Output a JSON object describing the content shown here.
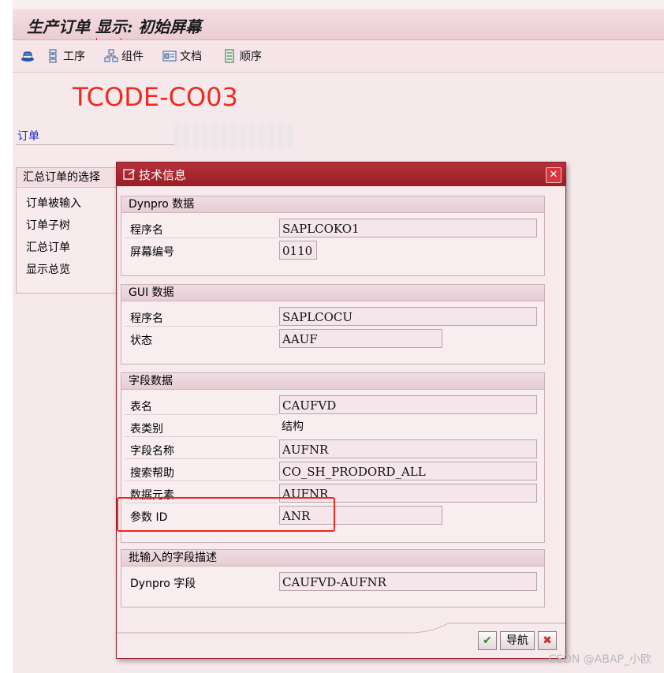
{
  "app": {
    "title": "生产订单 显示: 初始屏幕",
    "toolbar": [
      {
        "icon": "hat-icon",
        "label": ""
      },
      {
        "icon": "operations-icon",
        "label": "工序"
      },
      {
        "icon": "components-icon",
        "label": "组件"
      },
      {
        "icon": "documents-icon",
        "label": "文档"
      },
      {
        "icon": "sequence-icon",
        "label": "顺序"
      }
    ],
    "annotation": "TCODE-CO03",
    "order_label": "订单",
    "summary": {
      "title": "汇总订单的选择",
      "items": [
        "订单被输入",
        "订单子树",
        "汇总订单",
        "显示总览"
      ]
    }
  },
  "dialog": {
    "title": "技术信息",
    "groups": [
      {
        "title": "Dynpro 数据",
        "rows": [
          {
            "label": "程序名",
            "value": "SAPLCOKO1"
          },
          {
            "label": "屏幕编号",
            "value": "0110"
          }
        ]
      },
      {
        "title": "GUI 数据",
        "rows": [
          {
            "label": "程序名",
            "value": "SAPLCOCU"
          },
          {
            "label": "状态",
            "value": "AAUF"
          }
        ]
      },
      {
        "title": "字段数据",
        "rows": [
          {
            "label": "表名",
            "value": "CAUFVD"
          },
          {
            "label": "表类别",
            "value": "结构"
          },
          {
            "label": "字段名称",
            "value": "AUFNR"
          },
          {
            "label": "搜索帮助",
            "value": "CO_SH_PRODORD_ALL"
          },
          {
            "label": "数据元素",
            "value": "AUFNR"
          },
          {
            "label": "参数 ID",
            "value": "ANR"
          }
        ]
      },
      {
        "title": "批输入的字段描述",
        "rows": [
          {
            "label": "Dynpro 字段",
            "value": "CAUFVD-AUFNR"
          }
        ]
      }
    ],
    "buttons": {
      "ok": "✔",
      "navigate": "导航",
      "cancel": "✖"
    }
  },
  "watermark": "CSDN @ABAP_小欧",
  "colors": {
    "title_red": "#9a1e27",
    "annotation_red": "#ee2b1f",
    "order_label_blue": "#1a2ac8"
  }
}
